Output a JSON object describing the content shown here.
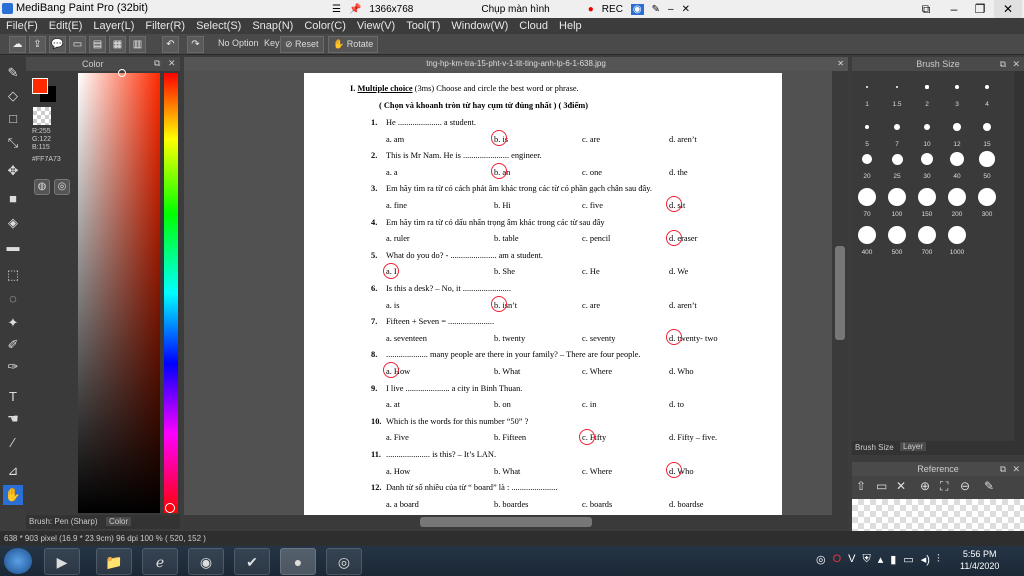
{
  "window": {
    "title": "MediBang Paint Pro (32bit)",
    "resolution": "1366x768",
    "screen_label": "Chụp màn hình",
    "rec_label": "REC"
  },
  "menu": [
    "File(F)",
    "Edit(E)",
    "Layer(L)",
    "Filter(R)",
    "Select(S)",
    "Snap(N)",
    "Color(C)",
    "View(V)",
    "Tool(T)",
    "Window(W)",
    "Cloud",
    "Help"
  ],
  "toolbar": {
    "no_option": "No Option",
    "key": "Key",
    "reset": "Reset",
    "rotate": "Rotate"
  },
  "color_panel": {
    "title": "Color",
    "r": "R:255",
    "g": "G:122",
    "b": "B:115",
    "hex": "#FF7A73",
    "fg_color": "#ff2a00",
    "brush_tab": "Brush: Pen (Sharp)",
    "color_tab": "Color"
  },
  "canvas": {
    "filename": "tng-hp-km-tra-15-pht-v-1-tit-ting-anh-lp-6-1-638.jpg"
  },
  "worksheet": {
    "heading_num": "I.",
    "heading_mc": "Multiple choice",
    "heading_rest": "(3ms)  Choose  and circle the best word or phrase.",
    "subheading": "( Chọn và khoanh tròn từ hay cụm từ đúng nhất ) ( 3điểm)",
    "questions": [
      {
        "n": "1.",
        "q": "He ..................... a student.",
        "o": [
          "a. am",
          "b. is",
          "c. are",
          "d. aren’t"
        ]
      },
      {
        "n": "2.",
        "q": "This is Mr Nam. He is ...................... engineer.",
        "o": [
          "a. a",
          "b. an",
          "c. one",
          "d. the"
        ]
      },
      {
        "n": "3.",
        "q": "Em hãy tìm ra từ có cách phát âm khác trong các từ có phần gạch chân sau đây.",
        "o": [
          "a. fine",
          "b. Hi",
          "c. five",
          "d. sit"
        ]
      },
      {
        "n": "4.",
        "q": "Em hãy tìm ra từ có dấu nhấn trọng âm khác trong các từ sau đây",
        "o": [
          "a. ruler",
          "b. table",
          "c. pencil",
          "d. eraser"
        ]
      },
      {
        "n": "5.",
        "q": "What do you do?  - ...................... am a student.",
        "o": [
          "a. I",
          "b. She",
          "c. He",
          "d. We"
        ]
      },
      {
        "n": "6.",
        "q": "Is this a desk? – No, it .......................",
        "o": [
          "a. is",
          "b. isn’t",
          "c. are",
          "d. aren’t"
        ]
      },
      {
        "n": "7.",
        "q": "Fifteen + Seven = ......................",
        "o": [
          "a. seventeen",
          "b. twenty",
          "c. seventy",
          "d. twenty- two"
        ]
      },
      {
        "n": "8.",
        "q": ".................... many people are there in your family? – There are four people.",
        "o": [
          "a. How",
          "b. What",
          "c. Where",
          "d. Who"
        ]
      },
      {
        "n": "9.",
        "q": "I live ..................... a city in Binh Thuan.",
        "o": [
          "a. at",
          "b. on",
          "c. in",
          "d. to"
        ]
      },
      {
        "n": "10.",
        "q": "Which is the words for this number “50” ?",
        "o": [
          "a. Five",
          "b. Fifteen",
          "c. Fifty",
          "d. Fifty – five."
        ]
      },
      {
        "n": "11.",
        "q": "..................... is this? – It’s LAN.",
        "o": [
          "a. How",
          "b. What",
          "c. Where",
          "d. Who"
        ]
      },
      {
        "n": "12.",
        "q": "Danh từ số nhiều của từ “ board” là : ......................",
        "o": [
          "a. a board",
          "b. boardes",
          "c. boards",
          "d. boardse"
        ]
      }
    ]
  },
  "brush_panel": {
    "title": "Brush Size",
    "sizes": [
      "1",
      "1.5",
      "2",
      "3",
      "4",
      "5",
      "7",
      "10",
      "12",
      "15",
      "20",
      "25",
      "30",
      "40",
      "50",
      "70",
      "100",
      "150",
      "200",
      "300",
      "400",
      "500",
      "700",
      "1000"
    ]
  },
  "tabs": {
    "brush_size": "Brush Size",
    "layer": "Layer"
  },
  "reference": {
    "title": "Reference"
  },
  "status": {
    "text": "638 * 903 pixel  (16.9 * 23.9cm)  96 dpi  100 %  ( 520, 152 )"
  },
  "taskbar": {
    "time": "5:56 PM",
    "date": "11/4/2020"
  }
}
